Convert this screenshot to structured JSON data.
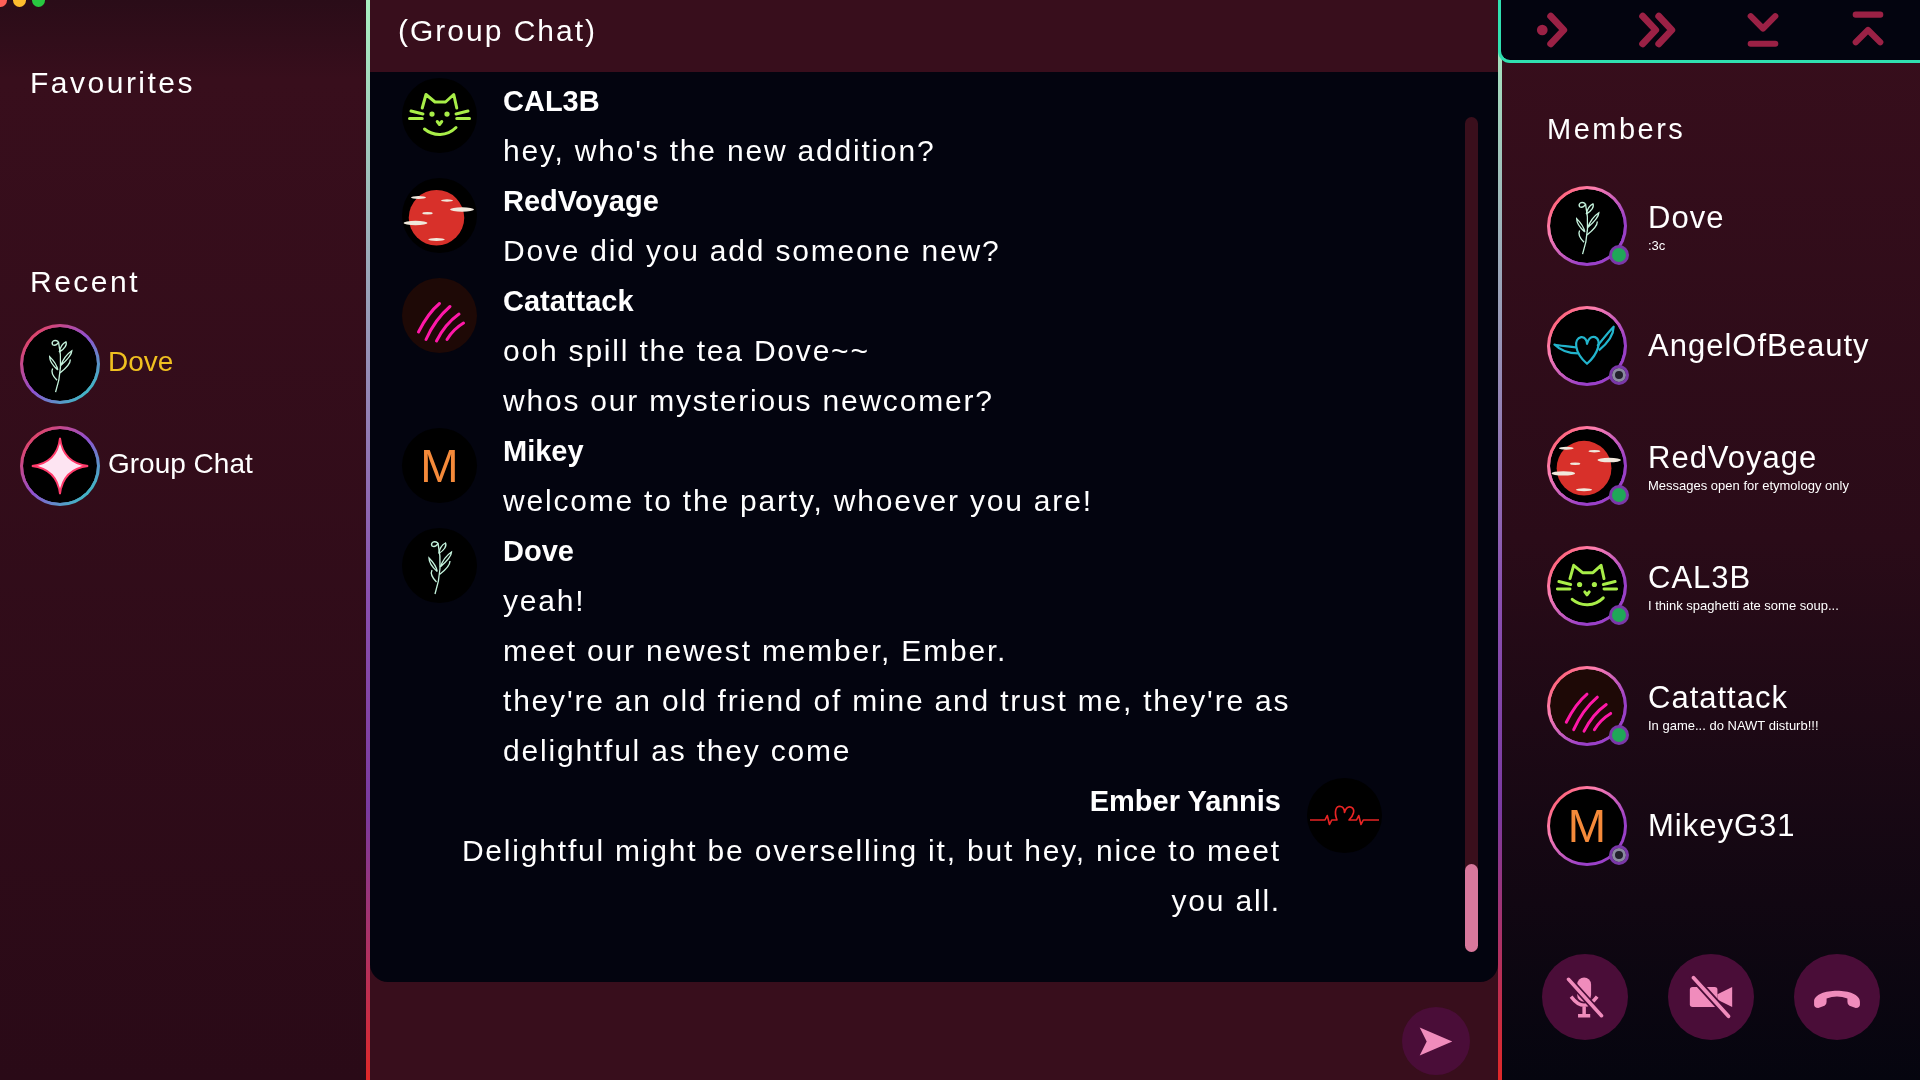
{
  "sidebar": {
    "favourites_title": "Favourites",
    "recent_title": "Recent",
    "recent": [
      {
        "label": "Dove",
        "avatar": {
          "kind": "plant"
        },
        "selected": true
      },
      {
        "label": "Group Chat",
        "avatar": {
          "kind": "sparkle"
        },
        "selected": false
      }
    ]
  },
  "chat": {
    "title": "(Group Chat)",
    "messages": [
      {
        "sender": "CAL3B",
        "avatar": {
          "kind": "cat"
        },
        "kind": "received",
        "lines": [
          "hey, who's the new addition?"
        ]
      },
      {
        "sender": "RedVoyage",
        "avatar": {
          "kind": "moon"
        },
        "kind": "received",
        "lines": [
          "Dove did you add someone new?"
        ]
      },
      {
        "sender": "Catattack",
        "avatar": {
          "kind": "claws"
        },
        "kind": "received",
        "lines": [
          "ooh spill the tea Dove~~",
          "whos our mysterious newcomer?"
        ]
      },
      {
        "sender": "Mikey",
        "avatar": {
          "kind": "letter",
          "initial": "M"
        },
        "kind": "received",
        "lines": [
          "welcome to the party, whoever you are!"
        ]
      },
      {
        "sender": "Dove",
        "avatar": {
          "kind": "plant"
        },
        "kind": "received",
        "lines": [
          "yeah!",
          "meet our newest member, Ember.",
          "they're an old friend of mine and trust me, they're as delightful as they come"
        ]
      },
      {
        "sender": "Ember Yannis",
        "avatar": {
          "kind": "heartbeat"
        },
        "kind": "sent",
        "lines": [
          "Delightful might be overselling it, but hey, nice to meet you all."
        ]
      }
    ]
  },
  "members": {
    "title": "Members",
    "list": [
      {
        "name": "Dove",
        "status": ":3c",
        "avatar": {
          "kind": "plant"
        },
        "online": true
      },
      {
        "name": "AngelOfBeauty",
        "avatar": {
          "kind": "heart-wings"
        },
        "online": false
      },
      {
        "name": "RedVoyage",
        "status": "Messages open for etymology only",
        "avatar": {
          "kind": "moon"
        },
        "online": true
      },
      {
        "name": "CAL3B",
        "status": "I think spaghetti ate some soup...",
        "avatar": {
          "kind": "cat"
        },
        "online": true
      },
      {
        "name": "Catattack",
        "status": "In game... do NAWT disturb!!!",
        "avatar": {
          "kind": "claws"
        },
        "online": true
      },
      {
        "name": "MikeyG31",
        "avatar": {
          "kind": "letter",
          "initial": "M"
        },
        "online": false
      }
    ]
  },
  "call_controls": {
    "mic_muted": true,
    "camera_off": true
  }
}
